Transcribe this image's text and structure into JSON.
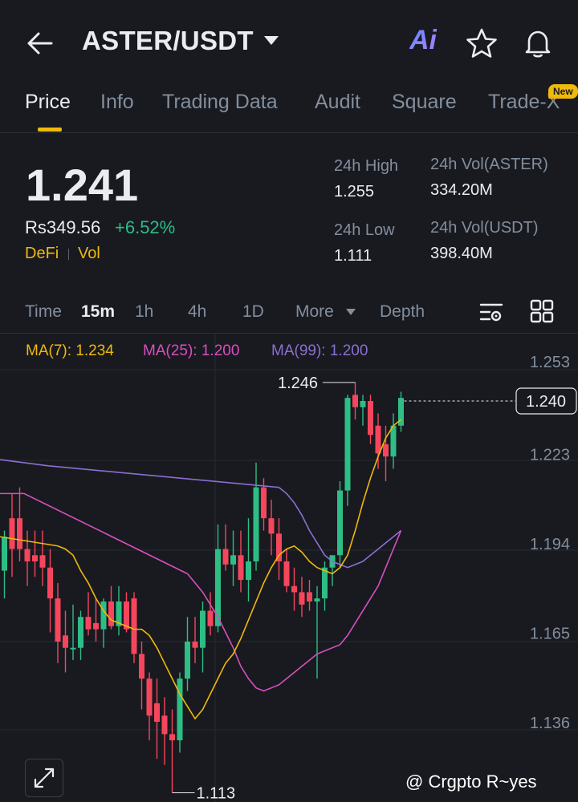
{
  "header": {
    "pair": "ASTER/USDT",
    "ai_label": "Ai"
  },
  "tabs": [
    {
      "label": "Price",
      "active": true
    },
    {
      "label": "Info"
    },
    {
      "label": "Trading Data"
    },
    {
      "label": "Audit"
    },
    {
      "label": "Square"
    },
    {
      "label": "Trade-X"
    }
  ],
  "new_badge": "New",
  "ticker": {
    "price": "1.241",
    "fiat": "Rs349.56",
    "change": "+6.52%",
    "tag1": "DeFi",
    "tag2": "Vol"
  },
  "stats": {
    "high_label": "24h High",
    "high_value": "1.255",
    "low_label": "24h Low",
    "low_value": "1.111",
    "vol_base_label": "24h Vol(ASTER)",
    "vol_base_value": "334.20M",
    "vol_quote_label": "24h Vol(USDT)",
    "vol_quote_value": "398.40M"
  },
  "intervals": [
    {
      "label": "Time"
    },
    {
      "label": "15m",
      "active": true
    },
    {
      "label": "1h"
    },
    {
      "label": "4h"
    },
    {
      "label": "1D"
    },
    {
      "label": "More"
    },
    {
      "label": "Depth"
    }
  ],
  "ma_labels": {
    "ma7": "MA(7): 1.234",
    "ma25": "MA(25): 1.200",
    "ma99": "MA(99): 1.200"
  },
  "colors": {
    "up": "#2ebd85",
    "down": "#f6465d",
    "ma7": "#f0b90b",
    "ma25": "#d94fbf",
    "ma99": "#8c6fd1",
    "accent": "#f0b90b"
  },
  "chart_data": {
    "type": "candlestick",
    "y_ticks": [
      1.253,
      1.223,
      1.194,
      1.165,
      1.136
    ],
    "ylim": [
      1.113,
      1.262
    ],
    "last_price_label": "1.240",
    "last_price": 1.24,
    "high_annotation": "1.246",
    "high_annotation_value": 1.246,
    "low_annotation": "1.113",
    "low_annotation_value": 1.113,
    "candles": [
      {
        "o": 1.185,
        "h": 1.198,
        "l": 1.176,
        "c": 1.196
      },
      {
        "o": 1.202,
        "h": 1.21,
        "l": 1.183,
        "c": 1.192
      },
      {
        "o": 1.202,
        "h": 1.212,
        "l": 1.188,
        "c": 1.192
      },
      {
        "o": 1.192,
        "h": 1.198,
        "l": 1.18,
        "c": 1.188
      },
      {
        "o": 1.19,
        "h": 1.198,
        "l": 1.183,
        "c": 1.188
      },
      {
        "o": 1.19,
        "h": 1.198,
        "l": 1.18,
        "c": 1.186
      },
      {
        "o": 1.186,
        "h": 1.192,
        "l": 1.165,
        "c": 1.176
      },
      {
        "o": 1.176,
        "h": 1.181,
        "l": 1.155,
        "c": 1.162
      },
      {
        "o": 1.164,
        "h": 1.172,
        "l": 1.152,
        "c": 1.16
      },
      {
        "o": 1.16,
        "h": 1.174,
        "l": 1.156,
        "c": 1.16
      },
      {
        "o": 1.16,
        "h": 1.172,
        "l": 1.156,
        "c": 1.17
      },
      {
        "o": 1.17,
        "h": 1.178,
        "l": 1.164,
        "c": 1.166
      },
      {
        "o": 1.168,
        "h": 1.176,
        "l": 1.162,
        "c": 1.166
      },
      {
        "o": 1.166,
        "h": 1.176,
        "l": 1.16,
        "c": 1.175
      },
      {
        "o": 1.175,
        "h": 1.18,
        "l": 1.166,
        "c": 1.167
      },
      {
        "o": 1.167,
        "h": 1.18,
        "l": 1.164,
        "c": 1.175
      },
      {
        "o": 1.175,
        "h": 1.178,
        "l": 1.165,
        "c": 1.166
      },
      {
        "o": 1.176,
        "h": 1.178,
        "l": 1.155,
        "c": 1.158
      },
      {
        "o": 1.158,
        "h": 1.162,
        "l": 1.14,
        "c": 1.15
      },
      {
        "o": 1.15,
        "h": 1.152,
        "l": 1.13,
        "c": 1.138
      },
      {
        "o": 1.142,
        "h": 1.15,
        "l": 1.124,
        "c": 1.136
      },
      {
        "o": 1.138,
        "h": 1.144,
        "l": 1.122,
        "c": 1.132
      },
      {
        "o": 1.132,
        "h": 1.14,
        "l": 1.113,
        "c": 1.13
      },
      {
        "o": 1.13,
        "h": 1.152,
        "l": 1.126,
        "c": 1.15
      },
      {
        "o": 1.15,
        "h": 1.17,
        "l": 1.146,
        "c": 1.162
      },
      {
        "o": 1.162,
        "h": 1.17,
        "l": 1.155,
        "c": 1.16
      },
      {
        "o": 1.16,
        "h": 1.175,
        "l": 1.152,
        "c": 1.172
      },
      {
        "o": 1.172,
        "h": 1.178,
        "l": 1.164,
        "c": 1.167
      },
      {
        "o": 1.167,
        "h": 1.2,
        "l": 1.165,
        "c": 1.192
      },
      {
        "o": 1.192,
        "h": 1.2,
        "l": 1.185,
        "c": 1.187
      },
      {
        "o": 1.187,
        "h": 1.198,
        "l": 1.18,
        "c": 1.19
      },
      {
        "o": 1.19,
        "h": 1.198,
        "l": 1.178,
        "c": 1.182
      },
      {
        "o": 1.182,
        "h": 1.202,
        "l": 1.175,
        "c": 1.188
      },
      {
        "o": 1.188,
        "h": 1.22,
        "l": 1.185,
        "c": 1.212
      },
      {
        "o": 1.212,
        "h": 1.215,
        "l": 1.198,
        "c": 1.202
      },
      {
        "o": 1.202,
        "h": 1.208,
        "l": 1.19,
        "c": 1.197
      },
      {
        "o": 1.197,
        "h": 1.202,
        "l": 1.182,
        "c": 1.188
      },
      {
        "o": 1.188,
        "h": 1.192,
        "l": 1.178,
        "c": 1.18
      },
      {
        "o": 1.18,
        "h": 1.186,
        "l": 1.172,
        "c": 1.178
      },
      {
        "o": 1.178,
        "h": 1.183,
        "l": 1.17,
        "c": 1.174
      },
      {
        "o": 1.178,
        "h": 1.182,
        "l": 1.172,
        "c": 1.175
      },
      {
        "o": 1.175,
        "h": 1.18,
        "l": 1.15,
        "c": 1.176
      },
      {
        "o": 1.176,
        "h": 1.188,
        "l": 1.172,
        "c": 1.186
      },
      {
        "o": 1.186,
        "h": 1.19,
        "l": 1.18,
        "c": 1.19
      },
      {
        "o": 1.19,
        "h": 1.214,
        "l": 1.186,
        "c": 1.211
      },
      {
        "o": 1.211,
        "h": 1.242,
        "l": 1.206,
        "c": 1.241
      },
      {
        "o": 1.242,
        "h": 1.246,
        "l": 1.234,
        "c": 1.238
      },
      {
        "o": 1.238,
        "h": 1.242,
        "l": 1.232,
        "c": 1.24
      },
      {
        "o": 1.24,
        "h": 1.242,
        "l": 1.226,
        "c": 1.229
      },
      {
        "o": 1.232,
        "h": 1.236,
        "l": 1.218,
        "c": 1.223
      },
      {
        "o": 1.226,
        "h": 1.232,
        "l": 1.214,
        "c": 1.222
      },
      {
        "o": 1.222,
        "h": 1.236,
        "l": 1.218,
        "c": 1.232
      },
      {
        "o": 1.232,
        "h": 1.243,
        "l": 1.23,
        "c": 1.241
      }
    ],
    "ma7": [
      1.193,
      1.192,
      1.19,
      1.185,
      1.181,
      1.176,
      1.172,
      1.169,
      1.168,
      1.167,
      1.166,
      1.166,
      1.164,
      1.16,
      1.155,
      1.15,
      1.145,
      1.141,
      1.137,
      1.14,
      1.145,
      1.15,
      1.155,
      1.158,
      1.163,
      1.169,
      1.175,
      1.181,
      1.186,
      1.19,
      1.192,
      1.193,
      1.191,
      1.188,
      1.186,
      1.185,
      1.184,
      1.186,
      1.19,
      1.198,
      1.207,
      1.215,
      1.222,
      1.228,
      1.232,
      1.234
    ],
    "ma25": [
      1.184,
      1.181,
      1.178,
      1.174,
      1.17,
      1.165,
      1.16,
      1.154,
      1.15,
      1.147,
      1.146,
      1.147,
      1.148,
      1.15,
      1.152,
      1.154,
      1.156,
      1.158,
      1.159,
      1.16,
      1.161,
      1.164,
      1.168,
      1.172,
      1.176,
      1.18,
      1.186,
      1.192,
      1.198
    ],
    "ma99": [
      1.212,
      1.21,
      1.207,
      1.203,
      1.198,
      1.194,
      1.19,
      1.188,
      1.187,
      1.186,
      1.187,
      1.188,
      1.19,
      1.192,
      1.194,
      1.196,
      1.198
    ],
    "watermark": "@ Crgpto R~yes"
  }
}
